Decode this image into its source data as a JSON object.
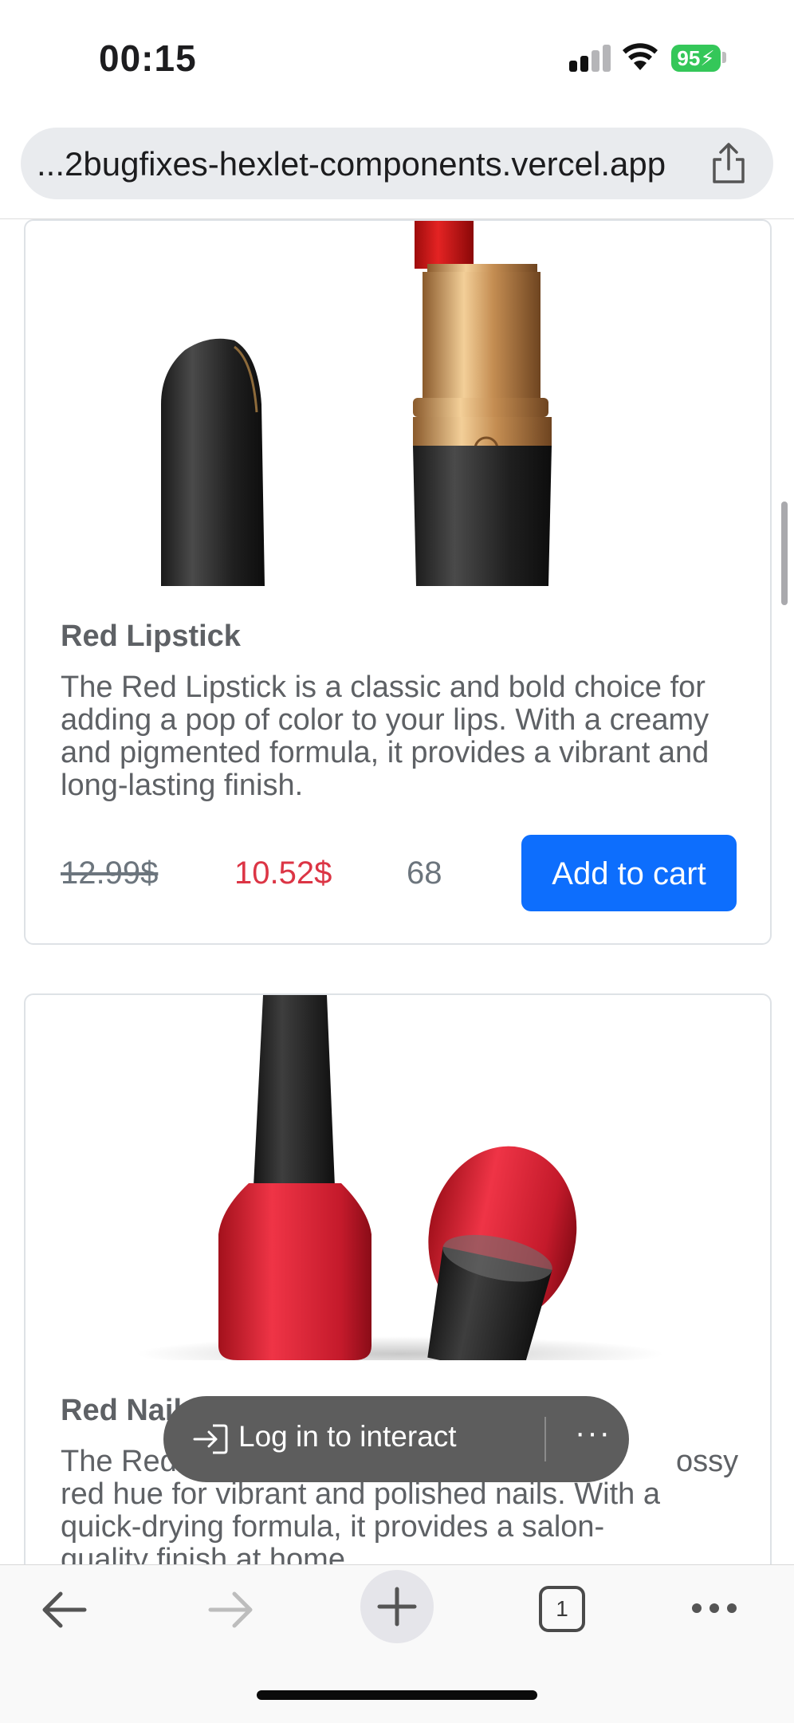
{
  "status_bar": {
    "time": "00:15",
    "battery": "95"
  },
  "url_bar": {
    "url": "...2bugfixes-hexlet-components.vercel.app"
  },
  "products": [
    {
      "title": "Red Lipstick",
      "description": "The Red Lipstick is a classic and bold choice for adding a pop of color to your lips. With a creamy and pigmented formula, it provides a vibrant and long-lasting finish.",
      "old_price": "12.99$",
      "new_price": "10.52$",
      "stock": "68",
      "cart_label": "Add to cart"
    },
    {
      "title": "Red Nail",
      "description_visible": "The Red",
      "description_lines": [
        "red hue for vibrant and polished nails. With a",
        "quick-drying formula, it provides a salon-",
        "quality finish at home."
      ],
      "description_tail": "ossy"
    }
  ],
  "login_pill": {
    "label": "Log in to interact",
    "more": "···"
  },
  "toolbar": {
    "tab_count": "1"
  },
  "colors": {
    "accent": "#0d6efd",
    "sale": "#dc3545",
    "battery": "#34c759"
  }
}
